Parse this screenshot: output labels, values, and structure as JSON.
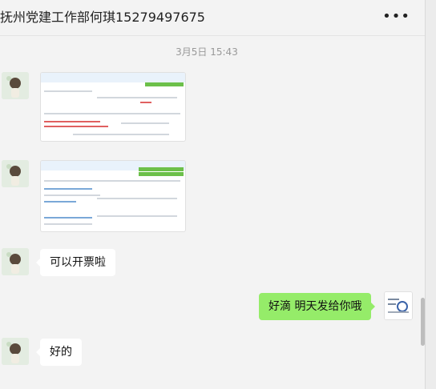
{
  "header": {
    "title": "抚州党建工作部何琪15279497675",
    "more_label": "•••"
  },
  "timestamp": "3月5日 15:43",
  "messages": [
    {
      "side": "left",
      "type": "image",
      "description": "order screenshot"
    },
    {
      "side": "left",
      "type": "image",
      "description": "invoice screenshot"
    },
    {
      "side": "left",
      "type": "text",
      "text": "可以开票啦"
    },
    {
      "side": "right",
      "type": "text",
      "text": "好滴 明天发给你哦"
    },
    {
      "side": "left",
      "type": "text",
      "text": "好的"
    }
  ],
  "colors": {
    "bubble_right": "#95ec69",
    "bubble_left": "#ffffff",
    "background": "#f3f3f3"
  }
}
